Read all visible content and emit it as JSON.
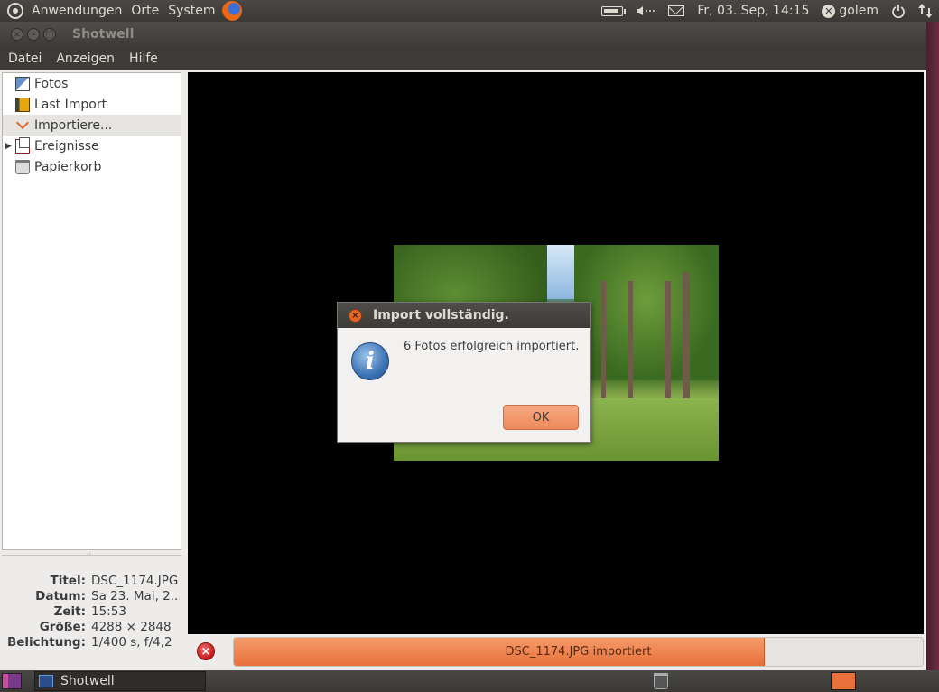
{
  "top_panel": {
    "menus": [
      "Anwendungen",
      "Orte",
      "System"
    ],
    "clock": "Fr, 03. Sep, 14:15",
    "user": "golem",
    "icons": [
      "ubuntu-logo-icon",
      "firefox-icon",
      "battery-icon",
      "volume-icon",
      "mail-icon",
      "user-status-icon",
      "power-icon",
      "network-icon"
    ]
  },
  "window": {
    "title": "Shotwell",
    "menubar": [
      "Datei",
      "Anzeigen",
      "Hilfe"
    ]
  },
  "sidebar": {
    "items": [
      {
        "label": "Fotos",
        "icon": "photos-icon"
      },
      {
        "label": "Last Import",
        "icon": "last-import-icon"
      },
      {
        "label": "Importiere...",
        "icon": "import-icon",
        "selected": true
      },
      {
        "label": "Ereignisse",
        "icon": "events-icon",
        "expander": "▶"
      },
      {
        "label": "Papierkorb",
        "icon": "trash-icon"
      }
    ]
  },
  "info": {
    "rows": [
      {
        "key": "Titel:",
        "value": "DSC_1174.JPG"
      },
      {
        "key": "Datum:",
        "value": "Sa 23. Mai, 2..."
      },
      {
        "key": "Zeit:",
        "value": "15:53"
      },
      {
        "key": "Größe:",
        "value": "4288 × 2848"
      },
      {
        "key": "Belichtung:",
        "value": "1/400 s, f/4,2"
      }
    ]
  },
  "dialog": {
    "title": "Import vollständig.",
    "message": "6 Fotos erfolgreich importiert.",
    "ok_label": "OK",
    "icon": "info-icon",
    "info_glyph": "i",
    "close_glyph": "×"
  },
  "statusbar": {
    "progress_text": "DSC_1174.JPG importiert",
    "progress_fraction": 0.77,
    "cancel_glyph": "×"
  },
  "bottom_panel": {
    "task_label": "Shotwell"
  },
  "colors": {
    "accent": "#e8703a",
    "panel": "#3c3b37"
  }
}
